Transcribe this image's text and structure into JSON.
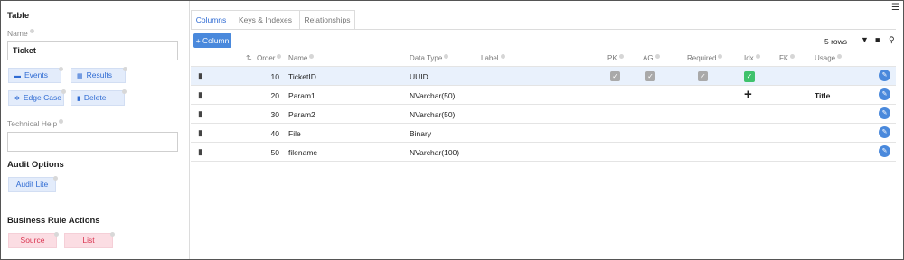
{
  "left": {
    "section_title": "Table",
    "name_label": "Name",
    "name_value": "Ticket",
    "buttons": [
      {
        "label": "Events",
        "icon": "inbox-icon"
      },
      {
        "label": "Results",
        "icon": "table-icon"
      },
      {
        "label": "Edge Case",
        "icon": "gear-icon"
      },
      {
        "label": "Delete",
        "icon": "trash-icon"
      }
    ],
    "technical_help_label": "Technical Help",
    "technical_help_value": "",
    "audit_title": "Audit Options",
    "audit_button": "Audit Lite",
    "rules_title": "Business Rule Actions",
    "rule_buttons": [
      "Source",
      "List"
    ]
  },
  "tabs": [
    {
      "label": "Columns",
      "active": true
    },
    {
      "label": "Keys & Indexes",
      "active": false
    },
    {
      "label": "Relationships",
      "active": false
    }
  ],
  "toolbar": {
    "add_column": "+ Column",
    "rows_count": "5 rows"
  },
  "columns": {
    "order": "Order",
    "name": "Name",
    "data_type": "Data Type",
    "label": "Label",
    "pk": "PK",
    "ag": "AG",
    "required": "Required",
    "idx": "Idx",
    "fk": "FK",
    "usage": "Usage"
  },
  "rows": [
    {
      "order": "10",
      "name": "TicketID",
      "data_type": "UUID",
      "label": "",
      "pk": true,
      "ag": true,
      "required": true,
      "idx": "checked",
      "fk": false,
      "usage": ""
    },
    {
      "order": "20",
      "name": "Param1",
      "data_type": "NVarchar(50)",
      "label": "",
      "pk": false,
      "ag": false,
      "required": false,
      "idx": "plus",
      "fk": false,
      "usage": "Title"
    },
    {
      "order": "30",
      "name": "Param2",
      "data_type": "NVarchar(50)",
      "label": "",
      "pk": false,
      "ag": false,
      "required": false,
      "idx": "",
      "fk": false,
      "usage": ""
    },
    {
      "order": "40",
      "name": "File",
      "data_type": "Binary",
      "label": "",
      "pk": false,
      "ag": false,
      "required": false,
      "idx": "",
      "fk": false,
      "usage": ""
    },
    {
      "order": "50",
      "name": "filename",
      "data_type": "NVarchar(100)",
      "label": "",
      "pk": false,
      "ag": false,
      "required": false,
      "idx": "",
      "fk": false,
      "usage": ""
    }
  ],
  "colors": {
    "accent": "#4a89dc",
    "idx_checked": "#3fc26c",
    "pink_button": "#fbdde3"
  }
}
